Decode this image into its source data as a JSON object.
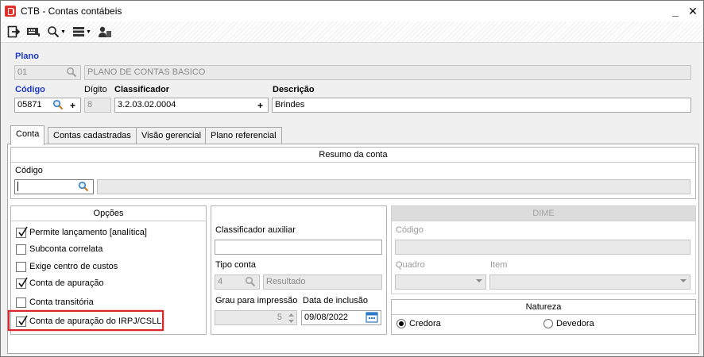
{
  "window": {
    "title": "CTB - Contas contábeis",
    "minimize": "_",
    "close": "✕"
  },
  "toolbar": {
    "icons": [
      "exit-icon",
      "keyboard-icon",
      "search-icon",
      "list-icon",
      "users-icon"
    ]
  },
  "plano": {
    "label": "Plano",
    "code": "01",
    "name": "PLANO DE CONTAS BASICO"
  },
  "conta": {
    "codigo_label": "Código",
    "codigo_value": "05871",
    "digito_label": "Dígito",
    "digito_value": "8",
    "classificador_label": "Classificador",
    "classificador_value": "3.2.03.02.0004",
    "descricao_label": "Descrição",
    "descricao_value": "Brindes"
  },
  "tabs": [
    {
      "label": "Conta",
      "active": true
    },
    {
      "label": "Contas cadastradas",
      "active": false
    },
    {
      "label": "Visão gerencial",
      "active": false
    },
    {
      "label": "Plano referencial",
      "active": false
    }
  ],
  "resumo": {
    "header": "Resumo da conta",
    "codigo_label": "Código",
    "codigo_value": "",
    "descricao_value": ""
  },
  "opcoes": {
    "header": "Opções",
    "items": [
      {
        "label": "Permite lançamento [analítica]",
        "checked": true
      },
      {
        "label": "Subconta correlata",
        "checked": false
      },
      {
        "label": "Exige centro de custos",
        "checked": false
      },
      {
        "label": "Conta de apuração",
        "checked": true
      },
      {
        "label": "Conta transitória",
        "checked": false
      },
      {
        "label": "Conta de apuração do IRPJ/CSLL",
        "checked": true
      }
    ]
  },
  "detalhes": {
    "classificador_aux_label": "Classificador auxiliar",
    "classificador_aux_value": "",
    "tipo_conta_label": "Tipo conta",
    "tipo_conta_code": "4",
    "tipo_conta_name": "Resultado",
    "grau_label": "Grau para impressão",
    "grau_value": "5",
    "data_label": "Data de inclusão",
    "data_value": "09/08/2022"
  },
  "dime": {
    "header": "DIME",
    "codigo_label": "Código",
    "quadro_label": "Quadro",
    "item_label": "Item"
  },
  "natureza": {
    "header": "Natureza",
    "options": [
      {
        "label": "Credora",
        "selected": true
      },
      {
        "label": "Devedora",
        "selected": false
      }
    ]
  },
  "colors": {
    "accent_label": "#1f3bc9",
    "highlight": "#d8262a",
    "app_icon": "#e0312b"
  }
}
